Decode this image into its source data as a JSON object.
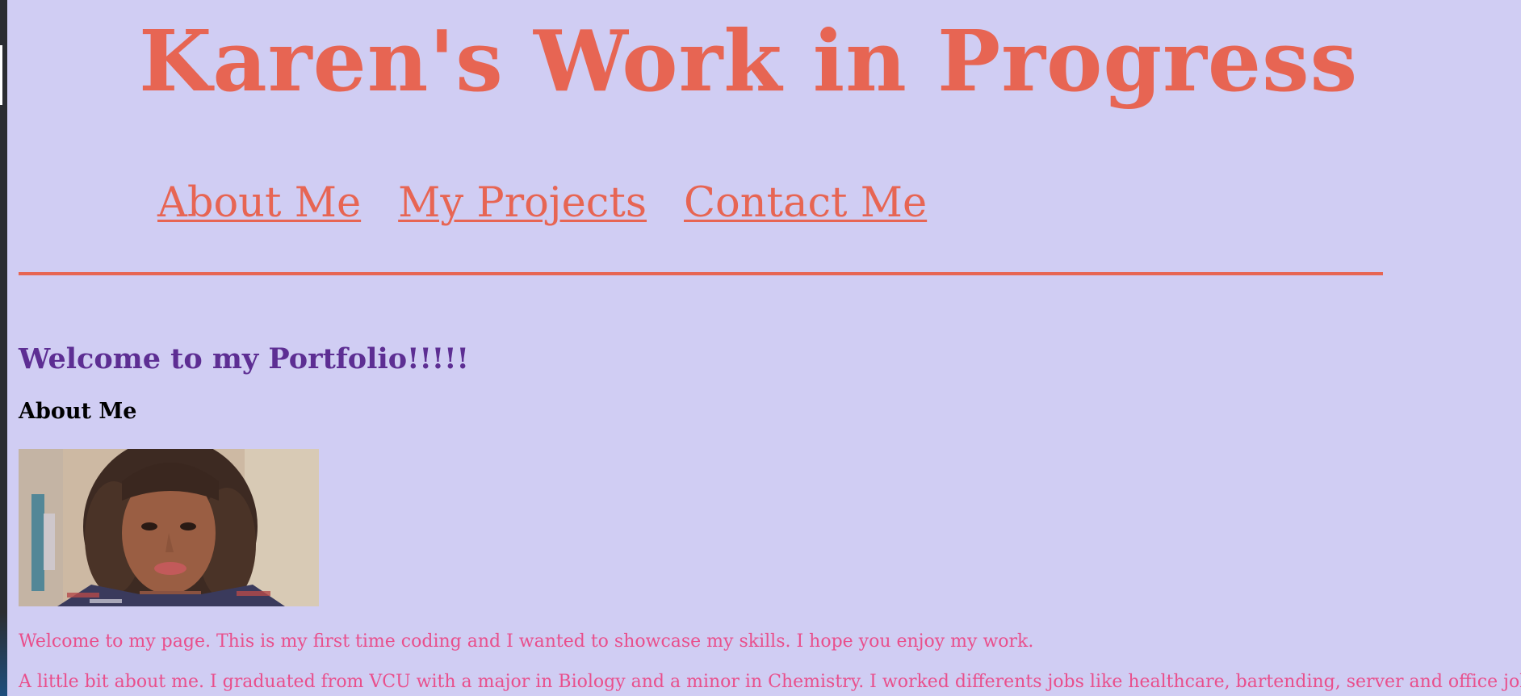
{
  "page": {
    "title": "Karen's Work in Progress"
  },
  "nav": {
    "items": [
      {
        "label": "About Me"
      },
      {
        "label": "My Projects"
      },
      {
        "label": "Contact Me"
      }
    ]
  },
  "main": {
    "welcome": "Welcome to my Portfolio!!!!!",
    "about_heading": "About Me",
    "photo_alt": "Portrait photo",
    "paragraphs": [
      "Welcome to my page. This is my first time coding and I wanted to showcase my skills. I hope you enjoy my work.",
      "A little bit about me. I graduated from VCU with a major in Biology and a minor in Chemistry. I worked differents jobs like healthcare, bartending, server and office jobs. I"
    ]
  },
  "colors": {
    "background": "#d0cdf3",
    "title_and_nav": "#e76553",
    "welcome": "#5d2e93",
    "paragraph_text": "#e94f8c"
  }
}
